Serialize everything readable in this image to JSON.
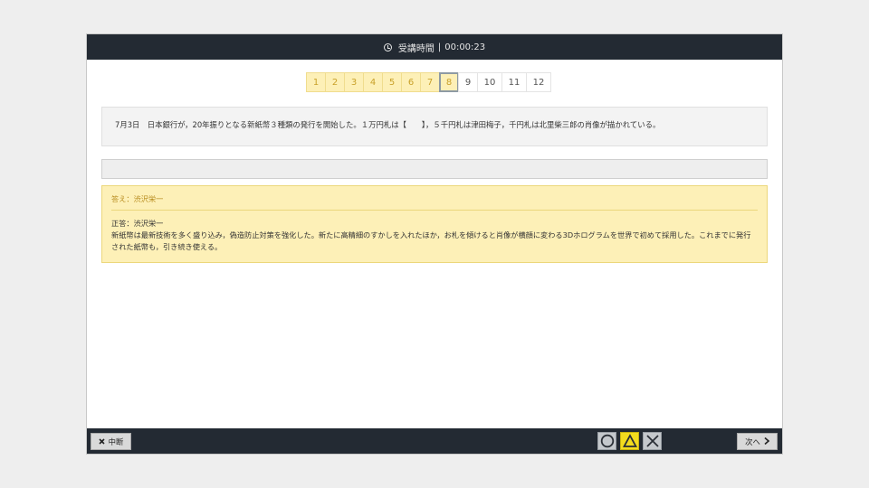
{
  "header": {
    "label": "受講時間",
    "separator": "|",
    "elapsed": "00:00:23"
  },
  "pager": {
    "pages": [
      {
        "label": "1",
        "state": "answered"
      },
      {
        "label": "2",
        "state": "answered"
      },
      {
        "label": "3",
        "state": "answered"
      },
      {
        "label": "4",
        "state": "answered"
      },
      {
        "label": "5",
        "state": "answered"
      },
      {
        "label": "6",
        "state": "answered"
      },
      {
        "label": "7",
        "state": "answered"
      },
      {
        "label": "8",
        "state": "current"
      },
      {
        "label": "9",
        "state": "unanswered"
      },
      {
        "label": "10",
        "state": "unanswered"
      },
      {
        "label": "11",
        "state": "unanswered"
      },
      {
        "label": "12",
        "state": "unanswered"
      }
    ]
  },
  "question": {
    "text": "7月3日　日本銀行が，20年振りとなる新紙幣３種類の発行を開始した。１万円札は【　　】，５千円札は津田梅子，千円札は北里柴三郎の肖像が描かれている。"
  },
  "answer_input": {
    "value": ""
  },
  "answer": {
    "heading": "答え：渋沢栄一",
    "correct": "正答：渋沢栄一",
    "explanation": "新紙幣は最新技術を多く盛り込み，偽造防止対策を強化した。新たに高精細のすかしを入れたほか，お札を傾けると肖像が横顔に変わる3Dホログラムを世界で初めて採用した。これまでに発行された紙幣も，引き続き使える。"
  },
  "footer": {
    "pause_label": "中断",
    "next_label": "次へ",
    "marks": [
      "circle",
      "triangle",
      "cross"
    ],
    "active_mark": "triangle"
  },
  "colors": {
    "bar": "#232a33",
    "answered_bg": "#fdf0b7",
    "answered_text": "#c9a12a",
    "mark_active": "#f3dc1e"
  }
}
